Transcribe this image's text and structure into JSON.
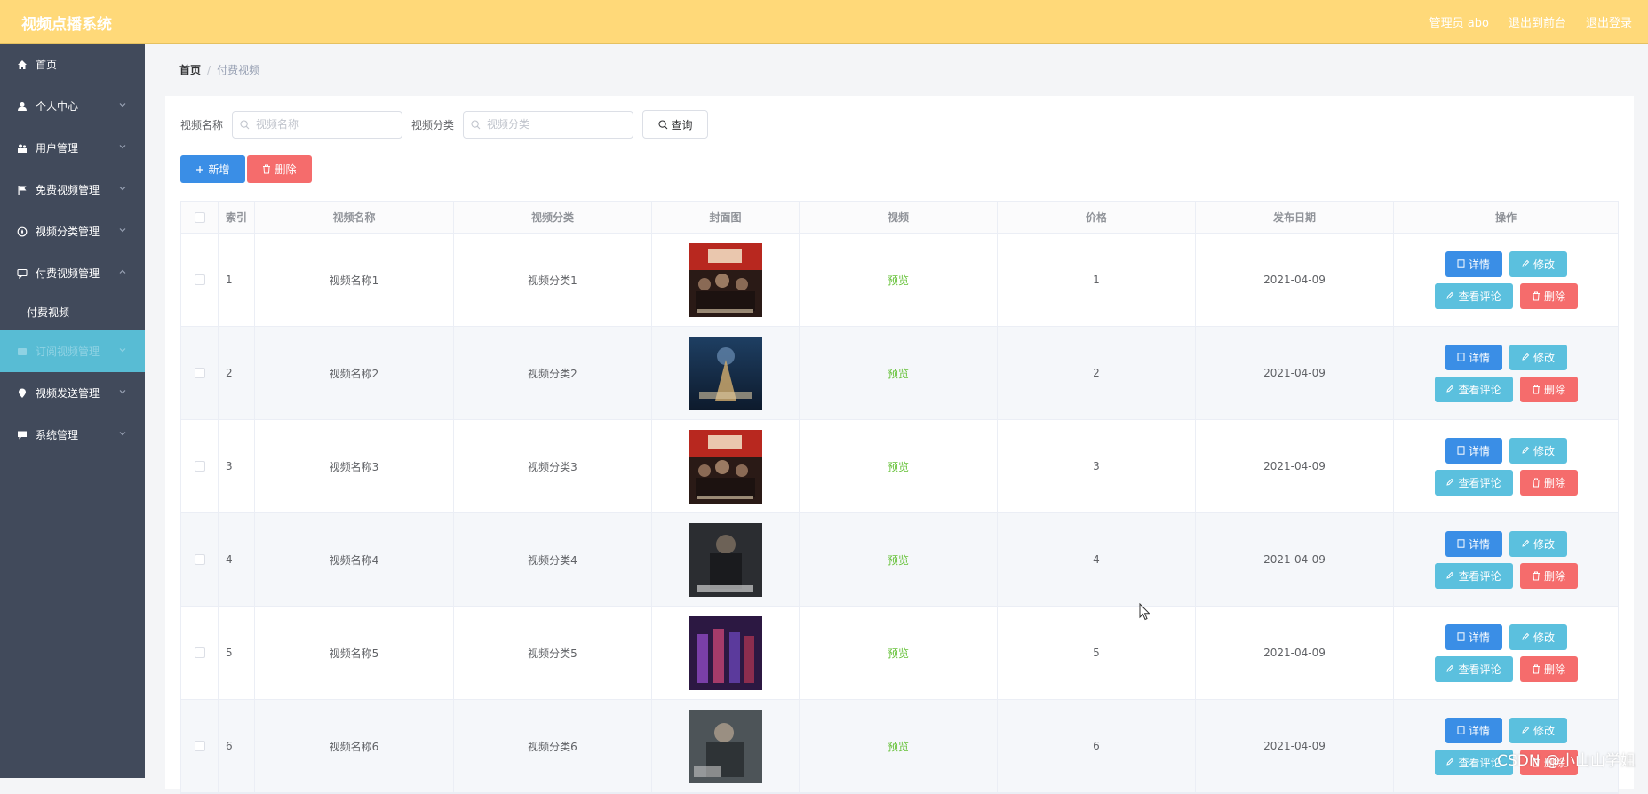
{
  "app": {
    "title": "视频点播系统"
  },
  "header": {
    "admin_label": "管理员 abo",
    "back_label": "退出到前台",
    "logout_label": "退出登录"
  },
  "sidebar": {
    "items": [
      {
        "label": "首页",
        "icon": "home-icon"
      },
      {
        "label": "个人中心",
        "icon": "user-icon"
      },
      {
        "label": "用户管理",
        "icon": "users-icon"
      },
      {
        "label": "免费视频管理",
        "icon": "flag-icon"
      },
      {
        "label": "视频分类管理",
        "icon": "compass-icon"
      },
      {
        "label": "付费视频管理",
        "icon": "comment-icon",
        "expanded": true
      },
      {
        "label": "付费视频",
        "sub": true
      },
      {
        "label": "订阅视频管理",
        "icon": "card-icon",
        "active": true
      },
      {
        "label": "视频发送管理",
        "icon": "location-icon"
      },
      {
        "label": "系统管理",
        "icon": "chat-icon"
      }
    ]
  },
  "breadcrumb": {
    "home": "首页",
    "current": "付费视频"
  },
  "search": {
    "name_label": "视频名称",
    "name_placeholder": "视频名称",
    "category_label": "视频分类",
    "category_placeholder": "视频分类",
    "query_label": "查询"
  },
  "toolbar": {
    "add_label": "新增",
    "delete_label": "删除"
  },
  "table": {
    "headers": [
      "索引",
      "视频名称",
      "视频分类",
      "封面图",
      "视频",
      "价格",
      "发布日期",
      "操作"
    ],
    "rows": [
      {
        "index": "1",
        "name": "视频名称1",
        "category": "视频分类1",
        "video": "预览",
        "price": "1",
        "date": "2021-04-09"
      },
      {
        "index": "2",
        "name": "视频名称2",
        "category": "视频分类2",
        "video": "预览",
        "price": "2",
        "date": "2021-04-09"
      },
      {
        "index": "3",
        "name": "视频名称3",
        "category": "视频分类3",
        "video": "预览",
        "price": "3",
        "date": "2021-04-09"
      },
      {
        "index": "4",
        "name": "视频名称4",
        "category": "视频分类4",
        "video": "预览",
        "price": "4",
        "date": "2021-04-09"
      },
      {
        "index": "5",
        "name": "视频名称5",
        "category": "视频分类5",
        "video": "预览",
        "price": "5",
        "date": "2021-04-09"
      },
      {
        "index": "6",
        "name": "视频名称6",
        "category": "视频分类6",
        "video": "预览",
        "price": "6",
        "date": "2021-04-09"
      }
    ],
    "ops": {
      "detail": "详情",
      "edit": "修改",
      "comment": "查看评论",
      "delete": "删除"
    }
  },
  "watermark": "CSDN @小山山学姐",
  "colors": {
    "topbar": "#ffd979",
    "sidebar": "#414a5b",
    "sidebar_active": "#58bcd4",
    "primary": "#3a8ee6",
    "info": "#5bc0de",
    "danger": "#f56c6c",
    "success": "#67c23a"
  }
}
